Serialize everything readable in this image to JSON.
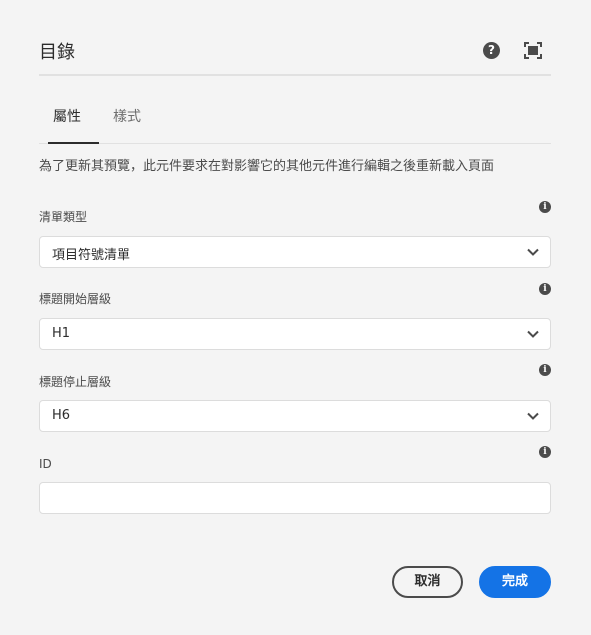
{
  "dialog": {
    "title": "目錄",
    "help_icon": "help-icon",
    "fullscreen_icon": "fullscreen-icon"
  },
  "tabs": [
    {
      "label": "屬性",
      "active": true
    },
    {
      "label": "樣式",
      "active": false
    }
  ],
  "note": "為了更新其預覽，此元件要求在對影響它的其他元件進行編輯之後重新載入頁面",
  "fields": {
    "list_type": {
      "label": "清單類型",
      "value": "項目符號清單"
    },
    "start_level": {
      "label": "標題開始層級",
      "value": "H1"
    },
    "stop_level": {
      "label": "標題停止層級",
      "value": "H6"
    },
    "id": {
      "label": "ID",
      "value": ""
    }
  },
  "buttons": {
    "cancel": "取消",
    "done": "完成"
  },
  "colors": {
    "accent": "#1473e6",
    "background": "#f4f4f4"
  }
}
